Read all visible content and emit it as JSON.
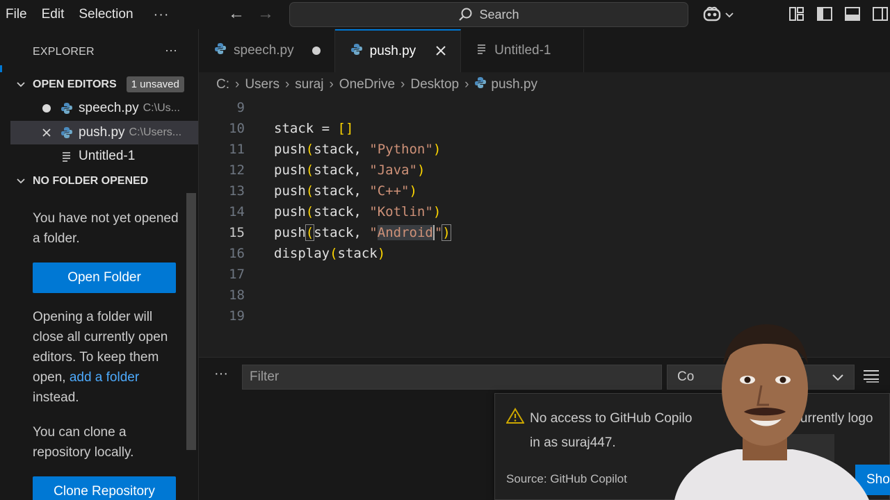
{
  "menu": {
    "file": "File",
    "edit": "Edit",
    "selection": "Selection",
    "more": "···"
  },
  "search": {
    "label": "Search"
  },
  "explorer": {
    "title": "EXPLORER",
    "more": "···",
    "open_editors": {
      "title": "OPEN EDITORS",
      "badge": "1 unsaved",
      "items": [
        {
          "name": "speech.py",
          "path": "C:\\Us...",
          "state": "modified"
        },
        {
          "name": "push.py",
          "path": "C:\\Users...",
          "state": "active"
        },
        {
          "name": "Untitled-1",
          "path": "",
          "state": "normal"
        }
      ]
    },
    "no_folder": {
      "title": "NO FOLDER OPENED",
      "text1": "You have not yet opened a folder.",
      "open_folder_button": "Open Folder",
      "text2_pre": "Opening a folder will close all currently open editors. To keep them open,",
      "text2_link": "add a folder",
      "text2_post": "instead.",
      "text3": "You can clone a repository locally.",
      "clone_button": "Clone Repository"
    }
  },
  "tabs": [
    {
      "label": "speech.py",
      "state": "modified"
    },
    {
      "label": "push.py",
      "state": "active"
    },
    {
      "label": "Untitled-1",
      "state": "normal"
    }
  ],
  "breadcrumb": [
    "C:",
    "Users",
    "suraj",
    "OneDrive",
    "Desktop",
    "push.py"
  ],
  "editor": {
    "current_line": 15,
    "lines": [
      {
        "num": "9",
        "text": ""
      },
      {
        "num": "10",
        "text": "stack = []"
      },
      {
        "num": "11",
        "text": "push(stack, \"Python\")"
      },
      {
        "num": "12",
        "text": "push(stack, \"Java\")"
      },
      {
        "num": "13",
        "text": "push(stack, \"C++\")"
      },
      {
        "num": "14",
        "text": "push(stack, \"Kotlin\")"
      },
      {
        "num": "15",
        "text": "push(stack, \"Android\")"
      },
      {
        "num": "16",
        "text": "display(stack)"
      },
      {
        "num": "17",
        "text": ""
      },
      {
        "num": "18",
        "text": ""
      },
      {
        "num": "19",
        "text": ""
      }
    ]
  },
  "panel": {
    "more": "···",
    "filter_placeholder": "Filter",
    "dropdown_value": "Co"
  },
  "notification": {
    "message_line1": "No access to GitHub Copilo",
    "message_line1_tail": "are currently logo",
    "message_line2": "in as suraj447.",
    "source": "Source: GitHub Copilot",
    "button": "Sho"
  },
  "colors": {
    "accent": "#0078d4",
    "string": "#ce9178",
    "bracket": "#ffd700",
    "link": "#4daafc",
    "warning": "#cca700"
  }
}
